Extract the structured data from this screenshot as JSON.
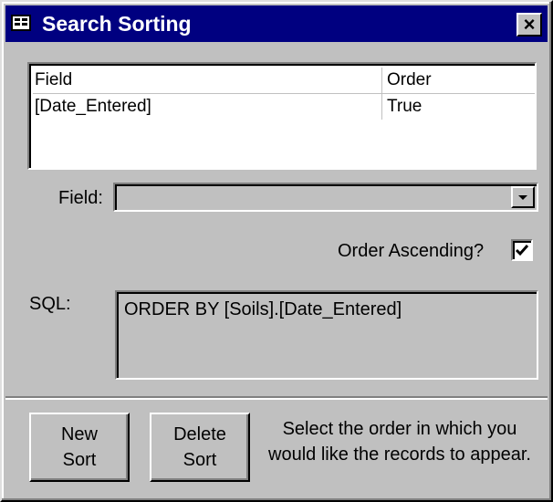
{
  "window": {
    "title": "Search Sorting",
    "title_icon": "form-icon",
    "close_icon": "close-icon",
    "close_glyph": "×"
  },
  "sort_list": {
    "columns": [
      "Field",
      "Order"
    ],
    "rows": [
      {
        "field": "[Date_Entered]",
        "order": "True"
      }
    ]
  },
  "field_select": {
    "label": "Field:",
    "value": ""
  },
  "order_ascending": {
    "label": "Order Ascending?",
    "checked": true
  },
  "sql": {
    "label": "SQL:",
    "value": "ORDER BY [Soils].[Date_Entered]"
  },
  "buttons": {
    "new_sort": [
      "New",
      "Sort"
    ],
    "delete_sort": [
      "Delete",
      "Sort"
    ]
  },
  "hint": [
    "Select the order in which you",
    "would like the records to appear."
  ],
  "colors": {
    "titlebar": "#000080",
    "face": "#c0c0c0"
  }
}
